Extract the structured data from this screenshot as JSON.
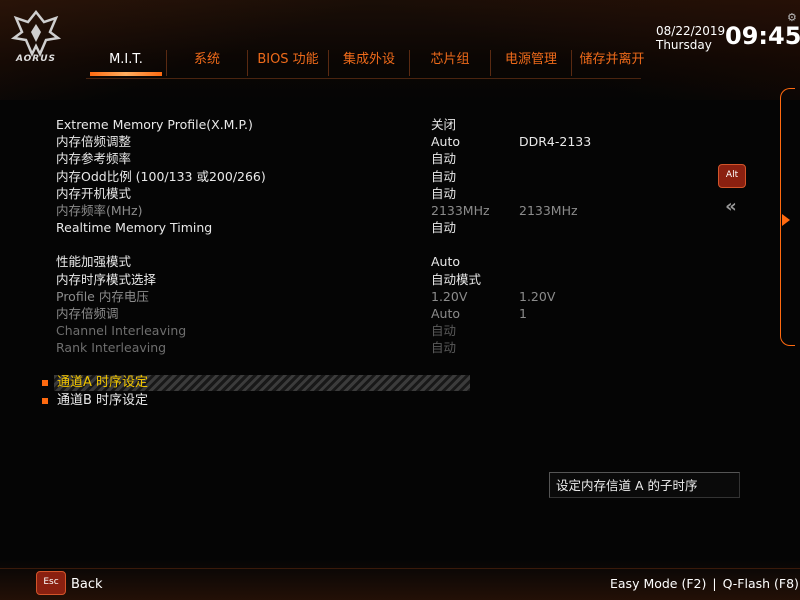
{
  "brand": {
    "logo_text": "AORUS"
  },
  "datetime": {
    "date": "08/22/2019",
    "weekday": "Thursday",
    "time": "09:45"
  },
  "tabs": [
    {
      "label": "M.I.T.",
      "active": true
    },
    {
      "label": "系统"
    },
    {
      "label": "BIOS 功能"
    },
    {
      "label": "集成外设"
    },
    {
      "label": "芯片组"
    },
    {
      "label": "电源管理"
    },
    {
      "label": "储存并离开"
    }
  ],
  "settings": [
    {
      "label": "Extreme Memory Profile(X.M.P.)",
      "value": "关闭",
      "value2": ""
    },
    {
      "label": "内存倍频调整",
      "value": "Auto",
      "value2": "DDR4-2133"
    },
    {
      "label": "内存参考频率",
      "value": "自动",
      "value2": ""
    },
    {
      "label": "内存Odd比例 (100/133 或200/266)",
      "value": "自动",
      "value2": ""
    },
    {
      "label": "内存开机模式",
      "value": "自动",
      "value2": ""
    },
    {
      "label": "内存频率(MHz)",
      "value": "2133MHz",
      "value2": "2133MHz"
    },
    {
      "label": "Realtime Memory Timing",
      "value": "自动",
      "value2": ""
    },
    {
      "label": "性能加强模式",
      "value": "Auto",
      "value2": ""
    },
    {
      "label": "内存时序模式选择",
      "value": "自动模式",
      "value2": ""
    },
    {
      "label": "Profile 内存电压",
      "value": "1.20V",
      "value2": "1.20V"
    },
    {
      "label": "内存倍频调",
      "value": "Auto",
      "value2": "1"
    },
    {
      "label": "Channel Interleaving",
      "value": "自动",
      "value2": ""
    },
    {
      "label": "Rank Interleaving",
      "value": "自动",
      "value2": ""
    }
  ],
  "submenus": [
    {
      "label": "通道A 时序设定",
      "selected": true
    },
    {
      "label": "通道B 时序设定"
    }
  ],
  "side": {
    "alt_label": "Alt",
    "collapse_icon": "«"
  },
  "help": {
    "text": "设定内存信道 A 的子时序"
  },
  "footer": {
    "esc_label": "Esc",
    "back_label": "Back",
    "easy_mode": "Easy Mode (F2)",
    "separator": "|",
    "qflash": "Q-Flash (F8)"
  },
  "colors": {
    "accent": "#ff6a10",
    "selected_text": "#f0c400",
    "tab_text": "#ee6a1a"
  }
}
